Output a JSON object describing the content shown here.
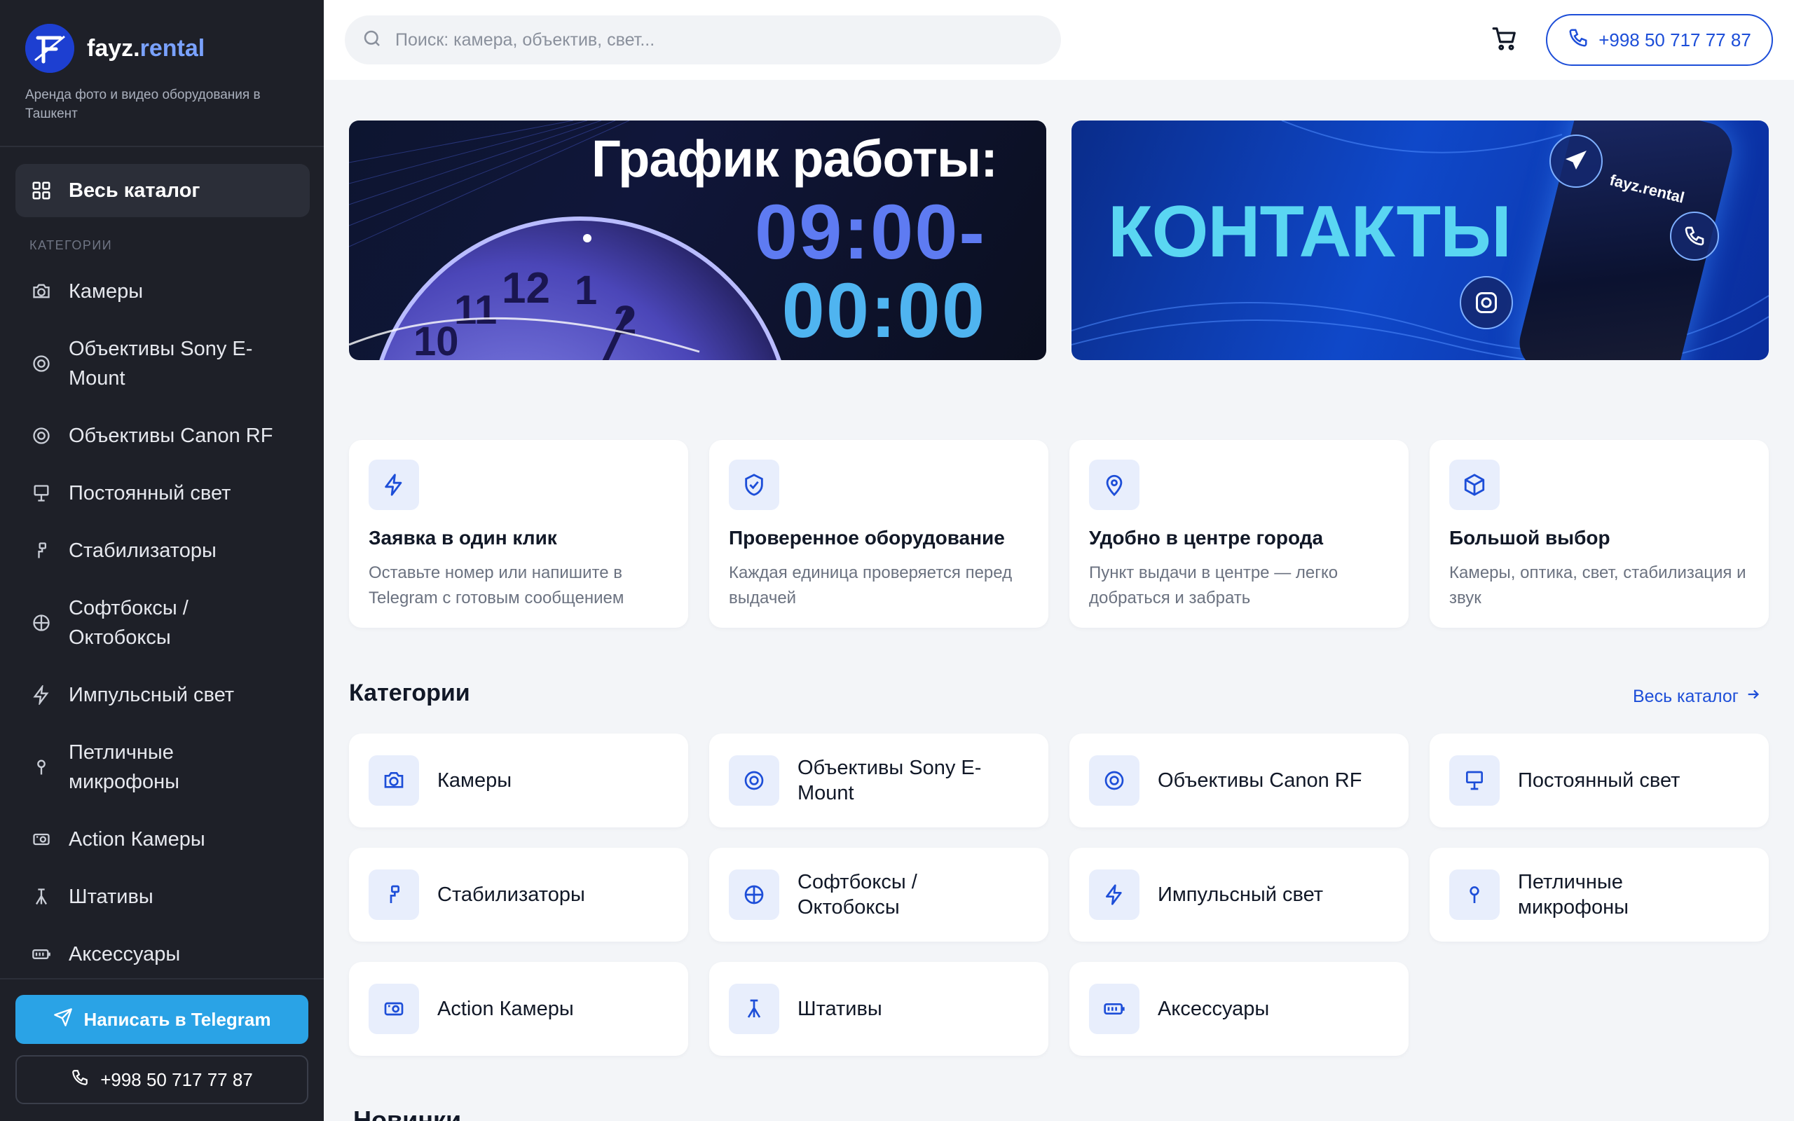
{
  "brand": {
    "name_main": "fayz.",
    "name_accent": "rental",
    "tagline": "Аренда фото и видео оборудования в Ташкент"
  },
  "sidebar": {
    "all_catalog": "Весь каталог",
    "categories_heading": "КАТЕГОРИИ",
    "items": [
      {
        "label": "Камеры",
        "icon": "camera-icon"
      },
      {
        "label": "Объективы Sony E-Mount",
        "icon": "lens-icon"
      },
      {
        "label": "Объективы Canon RF",
        "icon": "lens-icon"
      },
      {
        "label": "Постоянный свет",
        "icon": "light-panel-icon"
      },
      {
        "label": "Стабилизаторы",
        "icon": "gimbal-icon"
      },
      {
        "label": "Софтбоксы / Октобоксы",
        "icon": "softbox-icon"
      },
      {
        "label": "Импульсный свет",
        "icon": "flash-icon"
      },
      {
        "label": "Петличные микрофоны",
        "icon": "microphone-icon"
      },
      {
        "label": "Action Камеры",
        "icon": "action-camera-icon"
      },
      {
        "label": "Штативы",
        "icon": "tripod-icon"
      },
      {
        "label": "Аксессуары",
        "icon": "battery-icon"
      }
    ],
    "telegram_button": "Написать в Telegram",
    "phone_button": "+998 50 717 77 87"
  },
  "topbar": {
    "search_placeholder": "Поиск: камера, объектив, свет...",
    "phone": "+998 50 717 77 87"
  },
  "banners": {
    "schedule_title": "График работы:",
    "schedule_time_1": "09:00-",
    "schedule_time_2": "00:00",
    "contacts_title": "КОНТАКТЫ",
    "contacts_brand": "fayz.rental"
  },
  "features": [
    {
      "title": "Заявка в один клик",
      "desc": "Оставьте номер или напишите в Telegram с готовым сообщением",
      "icon": "lightning-icon"
    },
    {
      "title": "Проверенное оборудование",
      "desc": "Каждая единица проверяется перед выдачей",
      "icon": "shield-check-icon"
    },
    {
      "title": "Удобно в центре города",
      "desc": "Пункт выдачи в центре — легко добраться и забрать",
      "icon": "map-pin-icon"
    },
    {
      "title": "Большой выбор",
      "desc": "Камеры, оптика, свет, стабилизация и звук",
      "icon": "box-icon"
    }
  ],
  "categories": {
    "title": "Категории",
    "all_link": "Весь каталог",
    "items": [
      "Камеры",
      "Объективы Sony E-Mount",
      "Объективы Canon RF",
      "Постоянный свет",
      "Стабилизаторы",
      "Софтбоксы / Октобоксы",
      "Импульсный свет",
      "Петличные микрофоны",
      "Action Камеры",
      "Штативы",
      "Аксессуары"
    ]
  },
  "next_section_title": "Новинки",
  "colors": {
    "sidebar_bg": "#1e2028",
    "accent": "#1d4ed8",
    "telegram": "#2aa3e6",
    "icon_tile": "#e8eefc"
  }
}
